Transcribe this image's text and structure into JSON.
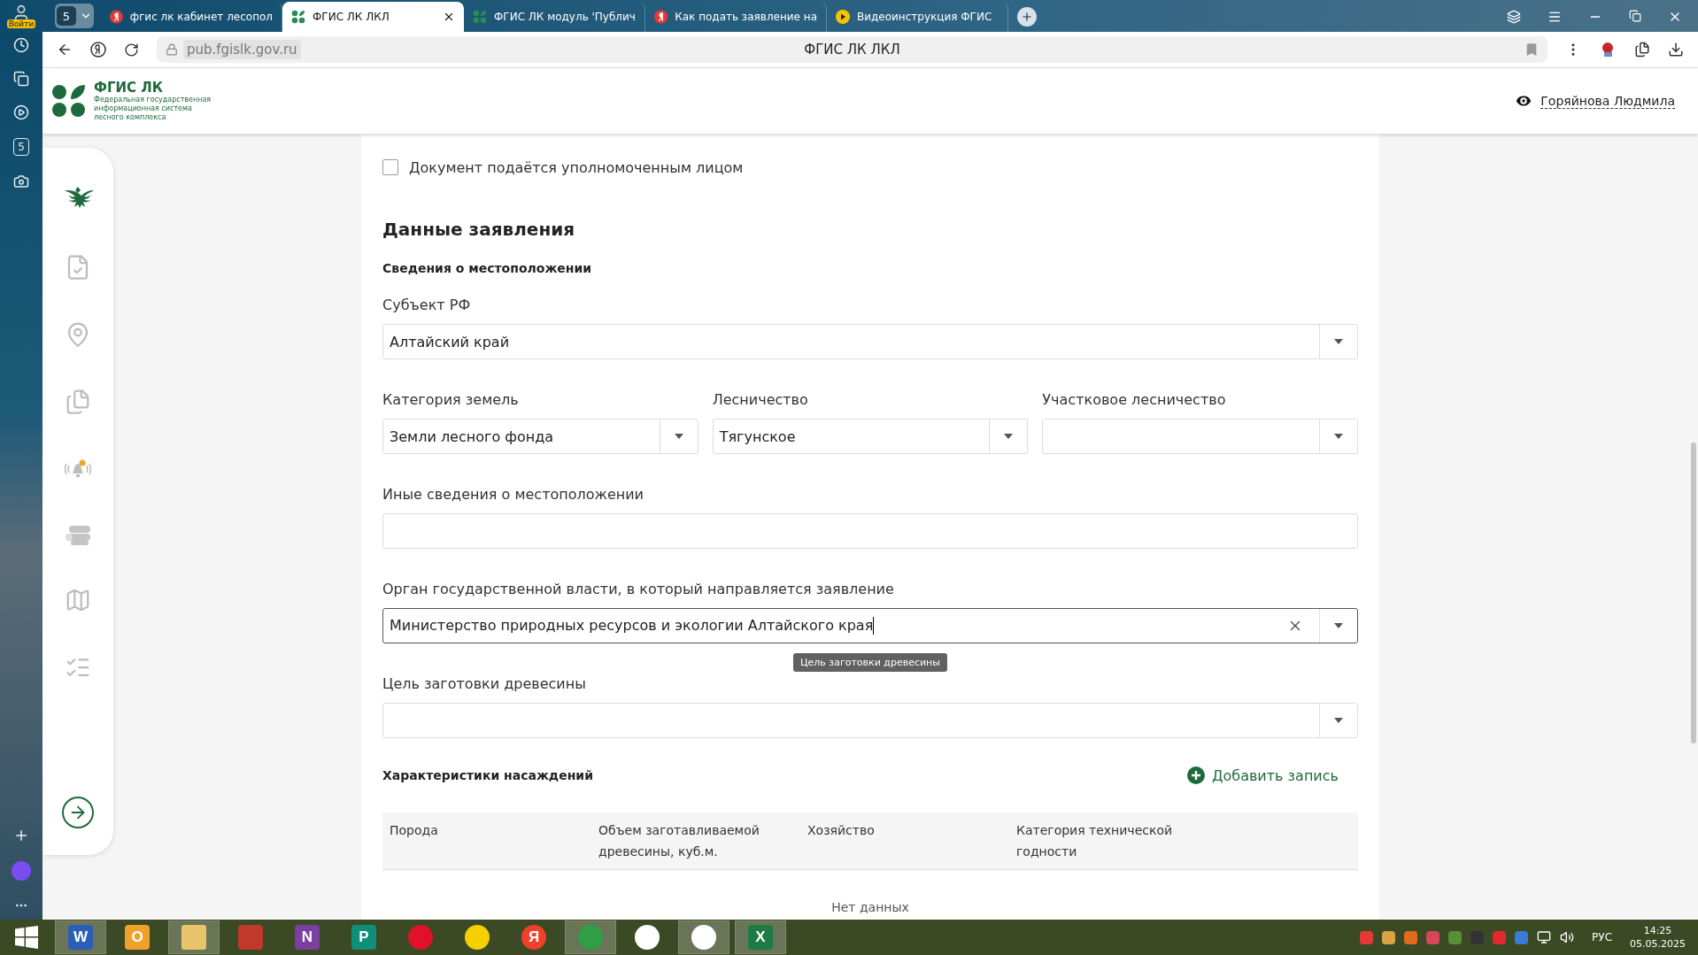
{
  "browser": {
    "login_label": "Войти",
    "tab_count": "5",
    "tabs": [
      {
        "title": "фгис лк кабинет лесопол",
        "kind": "yandex",
        "selected": false
      },
      {
        "title": "ФГИС ЛК ЛКЛ",
        "kind": "fgis",
        "selected": true
      },
      {
        "title": "ФГИС ЛК модуль 'Публич",
        "kind": "fgis",
        "selected": false
      },
      {
        "title": "Как подать заявление на",
        "kind": "yandex",
        "selected": false
      },
      {
        "title": "Видеоинструкция ФГИС",
        "kind": "play",
        "selected": false
      }
    ],
    "address": "pub.fgislk.gov.ru",
    "page_title": "ФГИС ЛК ЛКЛ",
    "sidebar_badge": "5"
  },
  "header": {
    "logo_title": "ФГИС ЛК",
    "logo_subtitle": [
      "Федеральная государственная",
      "информационная система",
      "лесного комплекса"
    ],
    "user": "Горяйнова Людмила"
  },
  "nav": {
    "items": [
      {
        "kind": "emblem"
      },
      {
        "kind": "document"
      },
      {
        "kind": "location"
      },
      {
        "kind": "copies"
      },
      {
        "kind": "alarm"
      },
      {
        "kind": "logs"
      },
      {
        "kind": "map"
      },
      {
        "kind": "checklist"
      }
    ]
  },
  "form": {
    "authorized": {
      "label": "Документ подаётся уполномоченным лицом",
      "checked": false
    },
    "section_title": "Данные заявления",
    "location_title": "Сведения о местоположении",
    "rows": [
      [
        {
          "label": "Субъект РФ",
          "value": "Алтайский край",
          "kind": "select"
        }
      ],
      [
        {
          "label": "Категория земель",
          "value": "Земли лесного фонда",
          "kind": "select"
        },
        {
          "label": "Лесничество",
          "value": "Тягунское",
          "kind": "select"
        },
        {
          "label": "Участковое лесничество",
          "kind": "select"
        }
      ],
      [
        {
          "label": "Иные сведения о местоположении",
          "kind": "input"
        }
      ],
      [
        {
          "label": "Орган государственной власти, в который направляется заявление",
          "value": "Министерство природных ресурсов и экологии Алтайского края",
          "kind": "select",
          "focused": true,
          "tooltip": "Цель заготовки древесины"
        }
      ],
      [
        {
          "label": "Цель заготовки древесины",
          "kind": "select"
        }
      ]
    ],
    "table": {
      "title": "Характеристики насаждений",
      "add_button": "Добавить запись",
      "columns": [
        "Порода",
        "Объем заготавливаемой древесины, куб.м.",
        "Хозяйство",
        "Категория технической годности"
      ],
      "empty": "Нет данных"
    }
  },
  "taskbar": {
    "apps": [
      {
        "kind": "word",
        "glyph": "W",
        "active": true
      },
      {
        "kind": "outlook",
        "glyph": "O",
        "active": false
      },
      {
        "kind": "folder",
        "active": true
      },
      {
        "kind": "access",
        "active": false
      },
      {
        "kind": "onenote",
        "glyph": "N",
        "active": false
      },
      {
        "kind": "publisher",
        "glyph": "P",
        "active": false
      },
      {
        "kind": "opera",
        "active": false
      },
      {
        "kind": "market",
        "active": false
      },
      {
        "kind": "yandex",
        "glyph": "Я",
        "active": false
      },
      {
        "kind": "chrome",
        "active": true
      },
      {
        "kind": "ccircle",
        "active": false
      },
      {
        "kind": "ybrowser",
        "active": true
      },
      {
        "kind": "excel",
        "glyph": "X",
        "active": true
      }
    ],
    "language": "РУС",
    "time": "14:25",
    "date": "05.05.2025"
  }
}
